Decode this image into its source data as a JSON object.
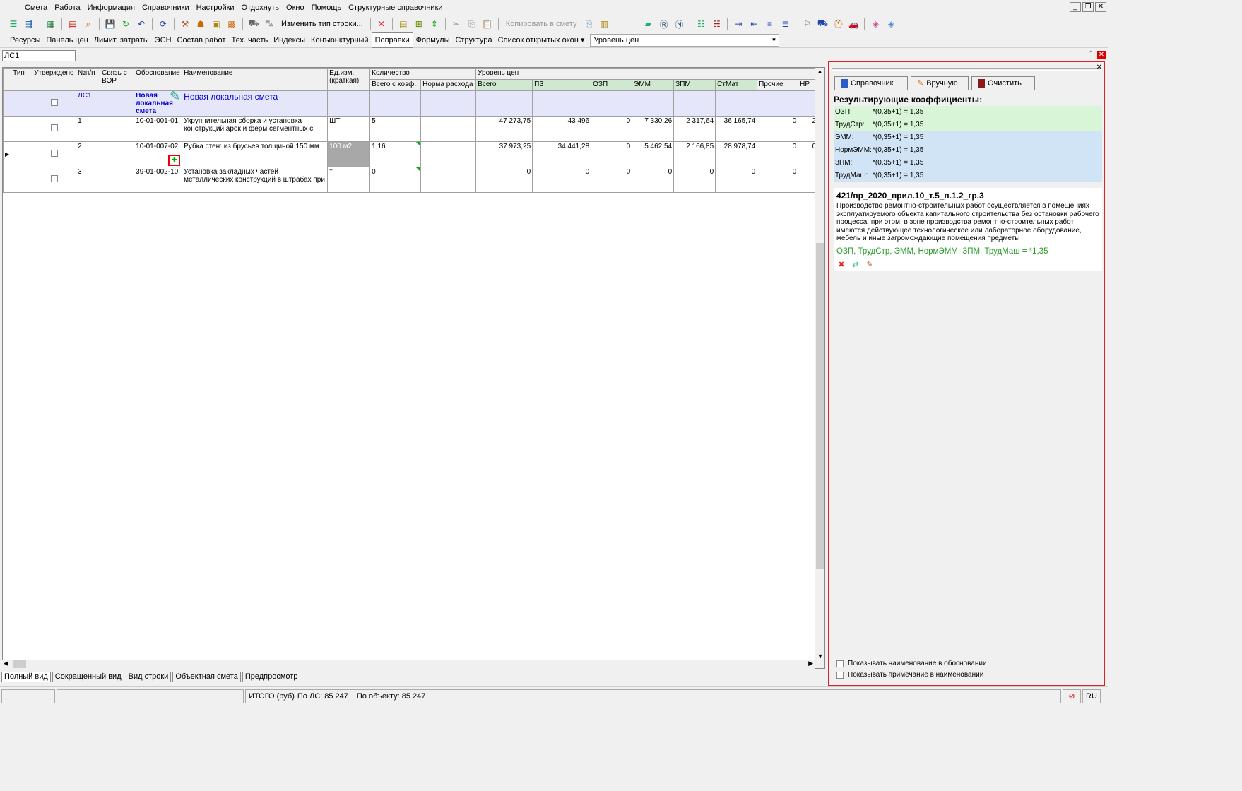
{
  "menu": [
    "Смета",
    "Работа",
    "Информация",
    "Справочники",
    "Настройки",
    "Отдохнуть",
    "Окно",
    "Помощь",
    "Структурные справочники"
  ],
  "toolbar": {
    "change_row_type": "Изменить тип строки...",
    "copy_to_estimate": "Копировать в смету"
  },
  "tabs": [
    "Ресурсы",
    "Панель цен",
    "Лимит. затраты",
    "ЭСН",
    "Состав работ",
    "Тех. часть",
    "Индексы",
    "Конъюнктурный",
    "Поправки",
    "Формулы",
    "Структура",
    "Список открытых окон ▾"
  ],
  "price_level_label": "Уровень цен",
  "name_field": "ЛС1",
  "grid": {
    "headers": {
      "type": "Тип",
      "approved": "Утверждено",
      "num": "№п/п",
      "link": "Связь с ВОР",
      "basis": "Обоснование",
      "name": "Наименование",
      "unit": "Ед.изм. (краткая)",
      "qty": "Количество",
      "qty_total": "Всего с коэф.",
      "qty_norm": "Норма расхода",
      "price_level": "Уровень цен",
      "total": "Всего",
      "pz": "ПЗ",
      "ozp": "ОЗП",
      "emm": "ЭММ",
      "zpm": "ЗПМ",
      "stmat": "СтМат",
      "other": "Прочие",
      "nr": "НР"
    },
    "section": {
      "code": "ЛС1",
      "basis": "Новая локальная смета",
      "title": "Новая локальная смета"
    },
    "rows": [
      {
        "num": "1",
        "basis": "10-01-001-01",
        "name": "Укрупнительная сборка и установка конструкций арок и ферм сегментных с",
        "unit": "ШТ",
        "qty": "5",
        "total": "47 273,75",
        "pz": "43 496",
        "ozp": "0",
        "emm": "7 330,26",
        "zpm": "2 317,64",
        "stmat": "36 165,74",
        "other": "0",
        "nr": "2"
      },
      {
        "num": "2",
        "basis": "10-01-007-02",
        "name": "Рубка стен: из брусьев толщиной 150 мм",
        "unit": "100 м2",
        "qty": "1,16",
        "total": "37 973,25",
        "pz": "34 441,28",
        "ozp": "0",
        "emm": "5 462,54",
        "zpm": "2 166,85",
        "stmat": "28 978,74",
        "other": "0",
        "nr": "0"
      },
      {
        "num": "3",
        "basis": "39-01-002-10",
        "name": "Установка закладных частей металлических конструкций в штрабах при",
        "unit": "т",
        "qty": "0",
        "total": "0",
        "pz": "0",
        "ozp": "0",
        "emm": "0",
        "zpm": "0",
        "stmat": "0",
        "other": "0",
        "nr": ""
      }
    ]
  },
  "right_panel": {
    "btn_reference": "Справочник",
    "btn_manual": "Вручную",
    "btn_clear": "Очистить",
    "result_title": "Результирующие коэффициенты:",
    "coefs": [
      {
        "k": "ОЗП:",
        "v": "*(0,35+1) = 1,35"
      },
      {
        "k": "ТрудСтр:",
        "v": "*(0,35+1) = 1,35"
      },
      {
        "k": "ЭММ:",
        "v": "*(0,35+1) = 1,35"
      },
      {
        "k": "НормЭММ:",
        "v": "*(0,35+1) = 1,35"
      },
      {
        "k": "ЗПМ:",
        "v": "*(0,35+1) = 1,35"
      },
      {
        "k": "ТрудМаш:",
        "v": "*(0,35+1) = 1,35"
      }
    ],
    "desc_title": "421/пр_2020_прил.10_т.5_п.1.2_гр.3",
    "desc_text": "Производство ремонтно-строительных работ осуществляется в помещениях эксплуатируемого объекта капитального строительства без остановки рабочего процесса, при этом: в зоне производства ремонтно-строительных работ имеются действующее технологическое или лабораторное оборудование, мебель и иные загромождающие помещения предметы",
    "desc_formula": "ОЗП, ТрудСтр, ЭММ, НормЭММ, ЗПМ, ТрудМаш = *1,35",
    "show_name_in_basis": "Показывать наименование в обосновании",
    "show_note_in_name": "Показывать примечание в наименовании"
  },
  "bottom_tabs": [
    "Полный вид",
    "Сокращенный вид",
    "Вид строки",
    "Объектная смета",
    "Предпросмотр"
  ],
  "status": {
    "total_label": "ИТОГО (руб)",
    "by_ls": "По ЛС: 85 247",
    "by_object": "По объекту: 85 247",
    "lang": "RU"
  }
}
